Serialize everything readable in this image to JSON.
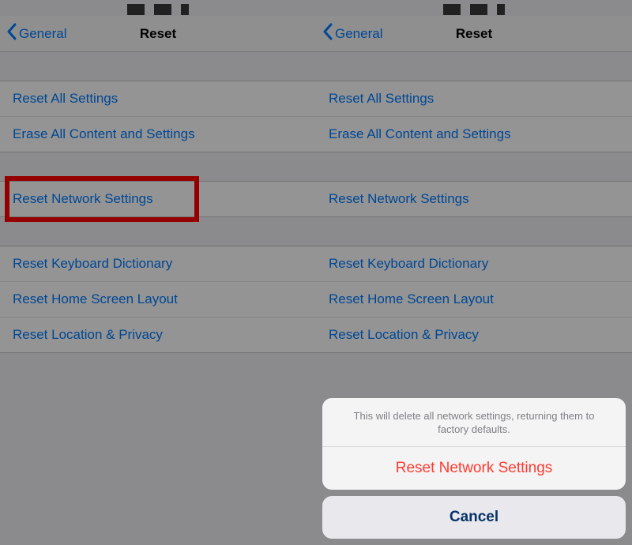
{
  "nav": {
    "back_label": "General",
    "title": "Reset"
  },
  "group1": {
    "reset_all": "Reset All Settings",
    "erase_all": "Erase All Content and Settings"
  },
  "group2": {
    "reset_network": "Reset Network Settings"
  },
  "group3": {
    "reset_keyboard": "Reset Keyboard Dictionary",
    "reset_home": "Reset Home Screen Layout",
    "reset_location": "Reset Location & Privacy"
  },
  "sheet": {
    "message": "This will delete all network settings, returning them to factory defaults.",
    "confirm": "Reset Network Settings",
    "cancel": "Cancel"
  }
}
